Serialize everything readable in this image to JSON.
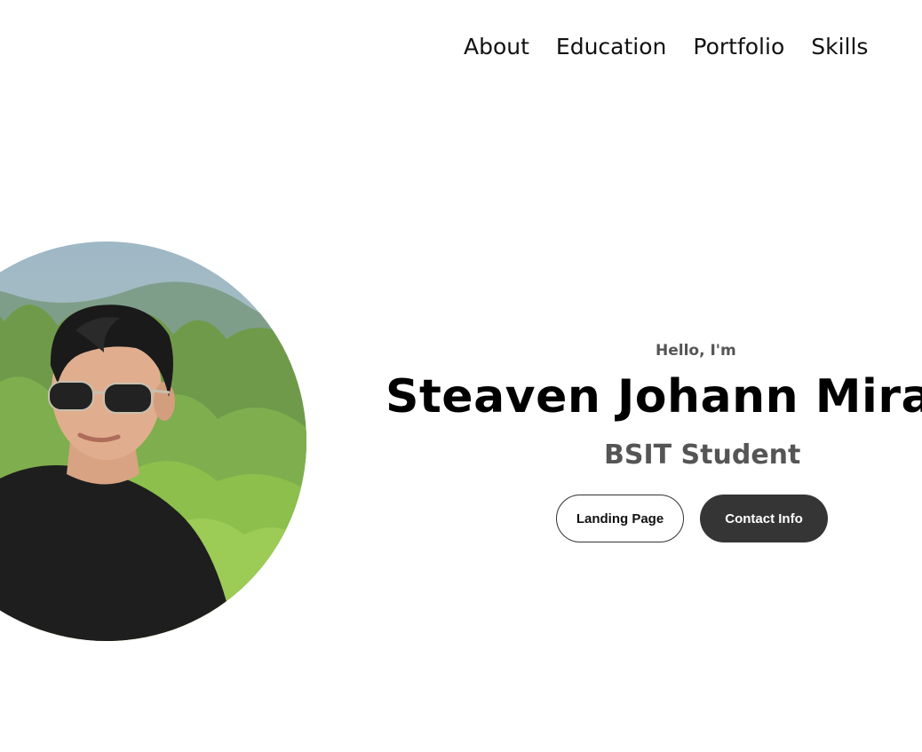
{
  "nav": {
    "links": [
      {
        "label": "About"
      },
      {
        "label": "Education"
      },
      {
        "label": "Portfolio"
      },
      {
        "label": "Skills"
      }
    ]
  },
  "profile": {
    "photo_alt": "profile-photo"
  },
  "hero": {
    "greeting": "Hello, I'm",
    "name": "Steaven Johann Miranda",
    "role": "BSIT Student",
    "buttons": {
      "landing": "Landing Page",
      "contact": "Contact Info"
    }
  },
  "colors": {
    "background": "#ffffff",
    "text_primary": "#000000",
    "text_secondary": "#555555",
    "button_dark": "#353535"
  }
}
